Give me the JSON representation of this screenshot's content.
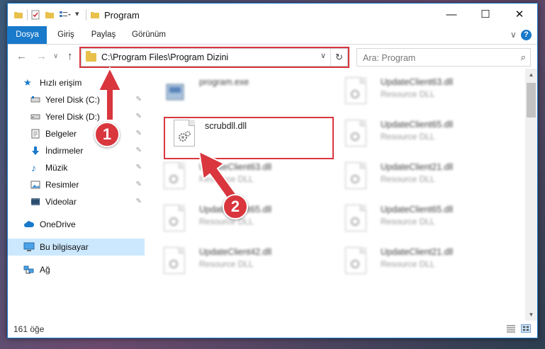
{
  "titlebar": {
    "title": "Program",
    "minimize": "—",
    "maximize": "☐",
    "close": "✕"
  },
  "ribbon": {
    "tabs": [
      "Dosya",
      "Giriş",
      "Paylaş",
      "Görünüm"
    ],
    "active_tab": "Dosya",
    "expand": "∨",
    "help": "?"
  },
  "nav": {
    "back": "←",
    "forward": "→",
    "recent": "∨",
    "up": "↑",
    "address": "C:\\Program Files\\Program Dizini",
    "address_dropdown": "∨",
    "refresh": "↻",
    "search_placeholder": "Ara: Program",
    "search_icon": "⌕"
  },
  "sidebar": {
    "items": [
      {
        "label": "Hızlı erişim",
        "icon": "star-icon",
        "pinned": false
      },
      {
        "label": "Yerel Disk (C:)",
        "icon": "drive-icon",
        "pinned": true
      },
      {
        "label": "Yerel Disk (D:)",
        "icon": "drive-icon",
        "pinned": true
      },
      {
        "label": "Belgeler",
        "icon": "documents-icon",
        "pinned": true
      },
      {
        "label": "İndirmeler",
        "icon": "download-icon",
        "pinned": true
      },
      {
        "label": "Müzik",
        "icon": "music-icon",
        "pinned": true
      },
      {
        "label": "Resimler",
        "icon": "pictures-icon",
        "pinned": true
      },
      {
        "label": "Videolar",
        "icon": "videos-icon",
        "pinned": true
      },
      {
        "label": "OneDrive",
        "icon": "cloud-icon",
        "pinned": false
      },
      {
        "label": "Bu bilgisayar",
        "icon": "computer-icon",
        "pinned": false
      },
      {
        "label": "Ağ",
        "icon": "network-icon",
        "pinned": false
      }
    ],
    "pin_glyph": "📌",
    "selected": "Bu bilgisayar"
  },
  "files": {
    "left": [
      {
        "name": "program.exe",
        "type": "",
        "blurred": true
      },
      {
        "name": "scrubdll.dll",
        "type": "",
        "blurred": false
      },
      {
        "name": "UpdateClient63.dll",
        "type": "Resource DLL",
        "blurred": true
      },
      {
        "name": "UpdateClient65.dll",
        "type": "Resource DLL",
        "blurred": true
      },
      {
        "name": "UpdateClient42.dll",
        "type": "Resource DLL",
        "blurred": true
      }
    ],
    "right": [
      {
        "name": "UpdateClient63.dll",
        "type": "Resource DLL",
        "blurred": true
      },
      {
        "name": "UpdateClient65.dll",
        "type": "Resource DLL",
        "blurred": true
      },
      {
        "name": "UpdateClient21.dll",
        "type": "Resource DLL",
        "blurred": true
      },
      {
        "name": "UpdateClient65.dll",
        "type": "Resource DLL",
        "blurred": true
      },
      {
        "name": "UpdateClient21.dll",
        "type": "Resource DLL",
        "blurred": true
      }
    ]
  },
  "scrollbar": {
    "up": "▲",
    "down": "▼"
  },
  "status": {
    "item_count": "161 öğe"
  },
  "annotations": {
    "step1": "1",
    "step2": "2"
  },
  "colors": {
    "accent": "#1979ca",
    "highlight": "#d9363e",
    "selection": "#cce8ff",
    "folder": "#e8c04a"
  }
}
